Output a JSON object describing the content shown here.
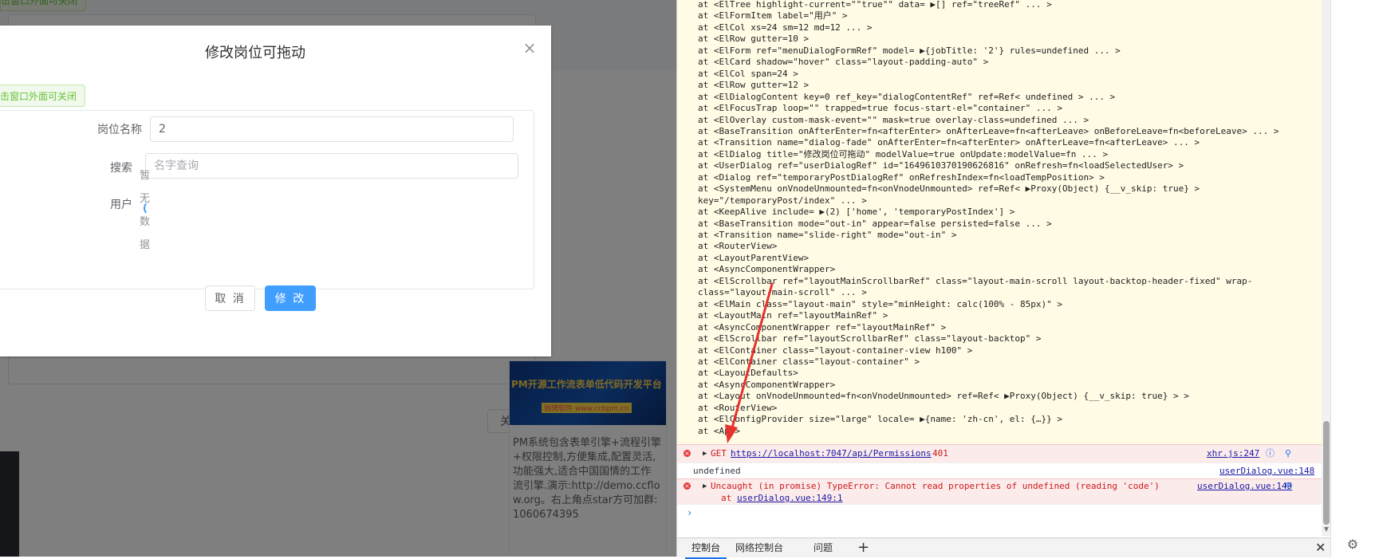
{
  "background_app": {
    "hint_top": "击窗口外面可关闭",
    "close_button": "关闭",
    "ad": {
      "banner_title": "PM开源工作流表单低代码开发平台",
      "banner_sub": "驰骋软件 www.ccbpm.cn",
      "text": "PM系统包含表单引擎+流程引擎+权限控制,方便集成,配置灵活,功能强大,适合中国国情的工作流引擎.演示:http://demo.ccflow.org。右上角点star方可加群:1060674395"
    }
  },
  "dialog": {
    "title": "修改岗位可拖动",
    "close_icon": "close-icon",
    "hint": "击窗口外面可关闭",
    "form": {
      "job_label": "岗位名称",
      "job_value": "2",
      "search_label": "搜索",
      "search_placeholder": "名字查询",
      "user_label": "用户",
      "empty_text": "暂无数据"
    },
    "cancel_label": "取 消",
    "submit_label": "修 改"
  },
  "devtools": {
    "stack_lines": [
      "  at <ElTree highlight-current=\"\"true\"\" data=  ▶[] ref=\"treeRef\"  ... >",
      "  at <ElFormItem label=\"用户\" >",
      "  at <ElCol xs=24 sm=12 md=12  ... >",
      "  at <ElRow gutter=10 >",
      "  at <ElForm ref=\"menuDialogFormRef\" model=  ▶{jobTitle: '2'} rules=undefined  ... >",
      "  at <ElCard shadow=\"hover\" class=\"layout-padding-auto\" >",
      "  at <ElCol span=24 >",
      "  at <ElRow gutter=12 >",
      "  at <ElDialogContent key=0 ref_key=\"dialogContentRef\" ref=Ref< undefined >  ... >",
      "  at <ElFocusTrap loop=\"\" trapped=true focus-start-el=\"container\"  ... >",
      "  at <ElOverlay custom-mask-event=\"\" mask=true overlay-class=undefined  ... >",
      "  at <BaseTransition onAfterEnter=fn<afterEnter> onAfterLeave=fn<afterLeave> onBeforeLeave=fn<beforeLeave>  ... >",
      "  at <Transition name=\"dialog-fade\" onAfterEnter=fn<afterEnter> onAfterLeave=fn<afterLeave>  ... >",
      "  at <ElDialog title=\"修改岗位可拖动\" modelValue=true onUpdate:modelValue=fn  ... >",
      "  at <UserDialog ref=\"userDialogRef\" id=\"1649610370190626816\" onRefresh=fn<loadSelectedUser> >",
      "  at <Dialog ref=\"temporaryPostDialogRef\" onRefreshIndex=fn<loadTempPosition> >",
      "  at <SystemMenu onVnodeUnmounted=fn<onVnodeUnmounted> ref=Ref<  ▶Proxy(Object) {__v_skip: true} >",
      "key=\"/temporaryPost/index\"  ... >",
      "  at <KeepAlive include=  ▶(2) ['home', 'temporaryPostIndex'] >",
      "  at <BaseTransition mode=\"out-in\" appear=false persisted=false  ... >",
      "  at <Transition name=\"slide-right\" mode=\"out-in\" >",
      "  at <RouterView>",
      "  at <LayoutParentView>",
      "  at <AsyncComponentWrapper>",
      "  at <ElScrollbar ref=\"layoutMainScrollbarRef\" class=\"layout-main-scroll layout-backtop-header-fixed\" wrap-",
      "class=\"layout-main-scroll\"  ... >",
      "  at <ElMain class=\"layout-main\" style=\"minHeight: calc(100% - 85px)\" >",
      "  at <LayoutMain ref=\"layoutMainRef\" >",
      "  at <AsyncComponentWrapper ref=\"layoutMainRef\" >",
      "  at <ElScrollbar ref=\"layoutScrollbarRef\" class=\"layout-backtop\" >",
      "  at <ElContainer class=\"layout-container-view h100\" >",
      "  at <ElContainer class=\"layout-container\" >",
      "  at <LayoutDefaults>",
      "  at <AsyncComponentWrapper>",
      "  at <Layout onVnodeUnmounted=fn<onVnodeUnmounted> ref=Ref<  ▶Proxy(Object) {__v_skip: true} > >",
      "  at <RouterView>",
      "  at <ElConfigProvider size=\"large\" locale=  ▶{name: 'zh-cn', el: {…}} >",
      "  at <App>"
    ],
    "error1": {
      "method": "GET",
      "url": "https://localhost:7047/api/Permissions",
      "status": "401",
      "source": "xhr.js:247"
    },
    "info": {
      "text": "undefined",
      "source": "userDialog.vue:148"
    },
    "error2": {
      "message": "Uncaught (in promise) TypeError: Cannot read properties of undefined (reading 'code')",
      "at_prefix": "at",
      "at_link": "userDialog.vue:149:1",
      "source": "userDialog.vue:149"
    },
    "prompt": "›",
    "tabs": [
      "控制台",
      "网络控制台",
      "问题"
    ],
    "add_tab": "+",
    "close": "✕",
    "settings_icon": "gear-icon"
  }
}
